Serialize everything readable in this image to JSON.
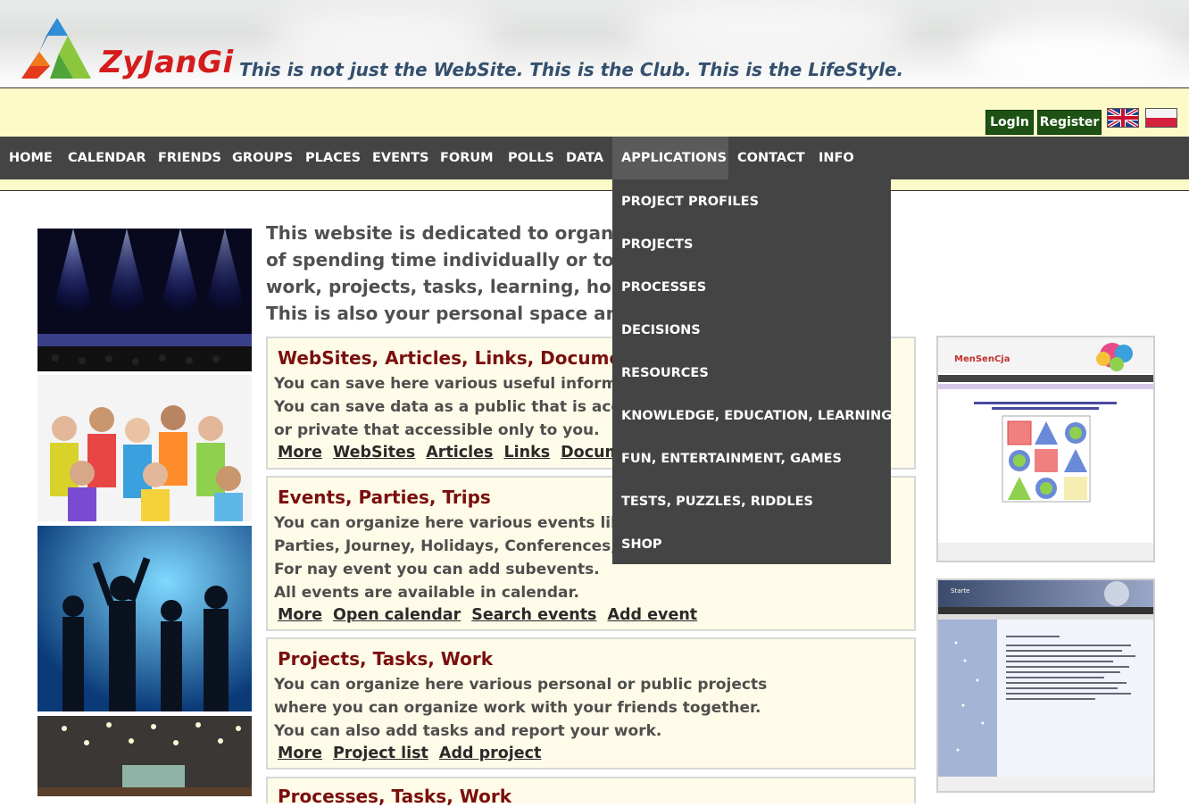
{
  "header": {
    "brand": "ZyJanGi",
    "tagline": "This is not just the WebSite. This is the Club. This is the LifeStyle."
  },
  "account": {
    "login_label": "LogIn",
    "register_label": "Register"
  },
  "nav": {
    "items": [
      {
        "label": "HOME"
      },
      {
        "label": "CALENDAR"
      },
      {
        "label": "FRIENDS"
      },
      {
        "label": "GROUPS"
      },
      {
        "label": "PLACES"
      },
      {
        "label": "EVENTS"
      },
      {
        "label": "FORUM"
      },
      {
        "label": "POLLS"
      },
      {
        "label": "DATA"
      },
      {
        "label": "APPLICATIONS"
      },
      {
        "label": "CONTACT"
      },
      {
        "label": "INFO"
      }
    ],
    "active": "APPLICATIONS"
  },
  "dropdown": {
    "items": [
      {
        "label": "PROJECT PROFILES"
      },
      {
        "label": "PROJECTS"
      },
      {
        "label": "PROCESSES"
      },
      {
        "label": "DECISIONS"
      },
      {
        "label": "RESOURCES"
      },
      {
        "label": "KNOWLEDGE, EDUCATION, LEARNING"
      },
      {
        "label": "FUN, ENTERTAINMENT, GAMES"
      },
      {
        "label": "TESTS, PUZZLES, RIDDLES"
      },
      {
        "label": "SHOP"
      }
    ]
  },
  "intro": {
    "lines": [
      "This website is dedicated to organisat",
      "of spending time individually or toget",
      "work, projects, tasks, learning, holida",
      "This is also your personal space and d"
    ]
  },
  "boxes": [
    {
      "title": "WebSites, Articles, Links, Documents",
      "lines": [
        "You can save here various useful informat",
        "You can save data as a public that is access",
        "or private that accessible only to you."
      ],
      "links": [
        "More",
        "WebSites",
        "Articles",
        "Links",
        "Documen"
      ]
    },
    {
      "title": "Events, Parties, Trips",
      "lines": [
        "You can organize here various events like",
        "Parties, Journey, Holidays, Conferences, Le",
        "For nay event you can add subevents.",
        "All events are available in calendar."
      ],
      "links": [
        "More",
        "Open calendar",
        "Search events",
        "Add event"
      ]
    },
    {
      "title": "Projects, Tasks, Work",
      "lines": [
        "You can organize here various personal or public projects",
        "where you can organize work with your friends together.",
        "You can also add tasks and report your work."
      ],
      "links": [
        "More",
        "Project list",
        "Add project"
      ]
    },
    {
      "title": "Processes, Tasks, Work",
      "lines": [],
      "links": []
    }
  ],
  "thumbs": [
    {
      "title": "MenSenCja"
    },
    {
      "title": "Starte"
    }
  ]
}
